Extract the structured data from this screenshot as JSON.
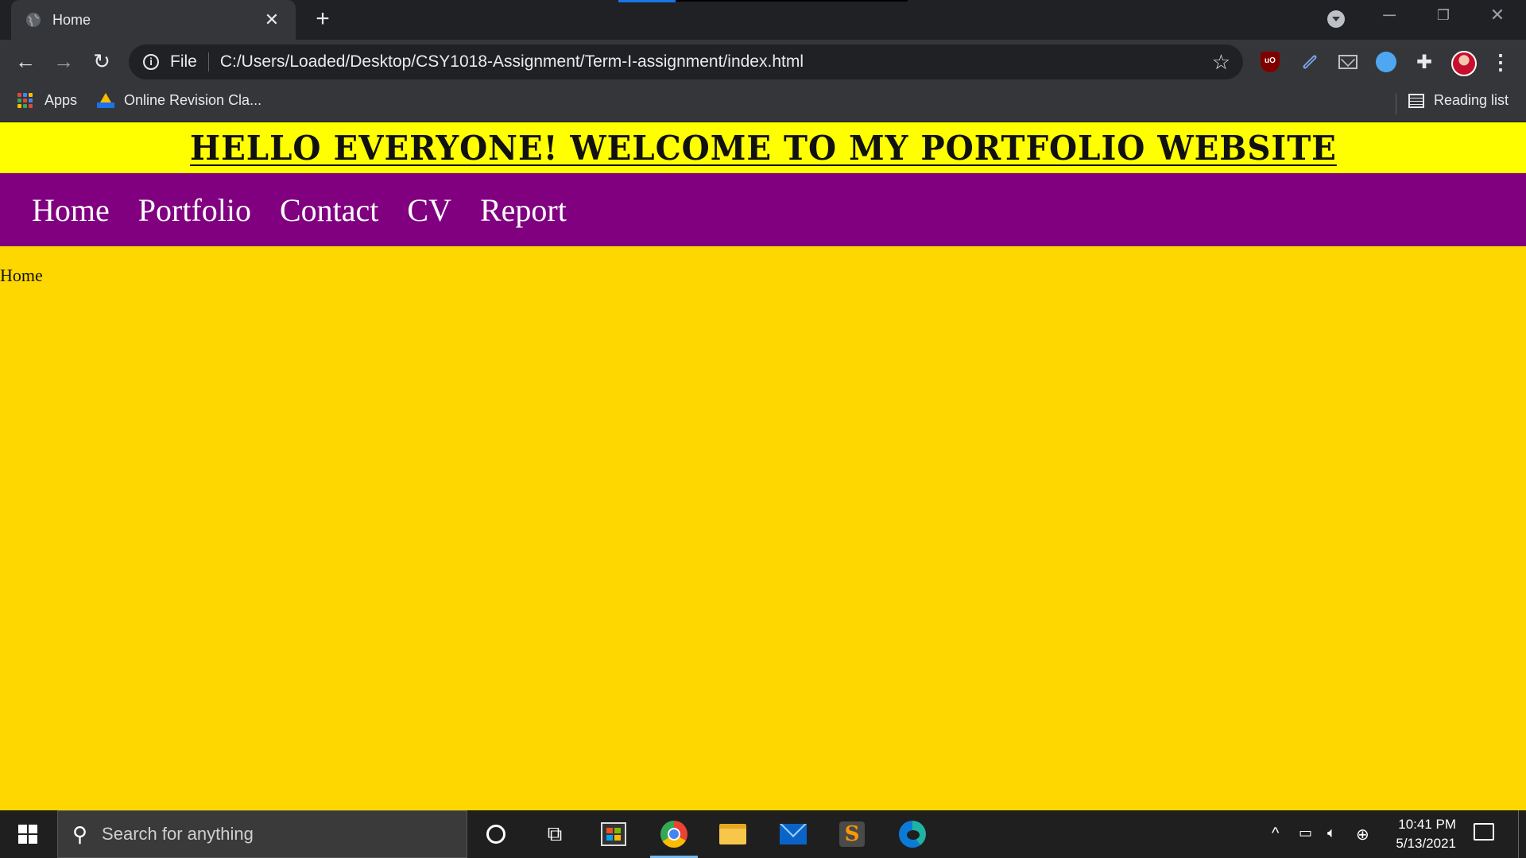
{
  "browser": {
    "tab": {
      "title": "Home",
      "close": "✕"
    },
    "new_tab": "+",
    "window_controls": {
      "minimize": "─",
      "restore": "❐",
      "close": "✕"
    },
    "toolbar": {
      "back": "←",
      "forward": "→",
      "reload": "↻",
      "site_info": "i",
      "scheme_label": "File",
      "url": "C:/Users/Loaded/Desktop/CSY1018-Assignment/Term-I-assignment/index.html",
      "bookmark_star": "☆",
      "extensions": [
        "ublock-origin-icon",
        "link-icon",
        "mail-icon",
        "blue-extension-icon"
      ],
      "extensions_puzzle": "✚",
      "menu": "⋮"
    },
    "bookmarks": {
      "apps": "Apps",
      "item1": "Online Revision Cla...",
      "reading_list": "Reading list"
    }
  },
  "page": {
    "banner_title": "Hello everyone! Welcome to my Portfolio website",
    "nav": [
      "Home",
      "Portfolio",
      "Contact",
      "CV",
      "Report"
    ],
    "breadcrumb": "Home",
    "colors": {
      "banner": "#ffff00",
      "nav": "#800080",
      "body": "#ffd700"
    }
  },
  "taskbar": {
    "search_placeholder": "Search for anything",
    "pinned": [
      "cortana",
      "task-view",
      "microsoft-store",
      "google-chrome",
      "file-explorer",
      "mail",
      "sublime-text",
      "microsoft-edge"
    ],
    "tray_chevron": "^",
    "time": "10:41 PM",
    "date": "5/13/2021"
  }
}
